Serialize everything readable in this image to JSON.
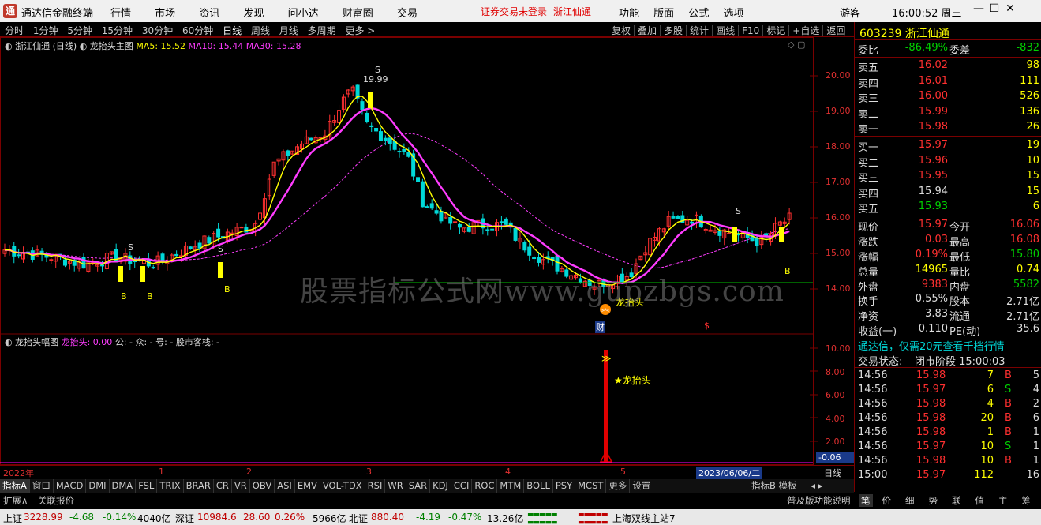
{
  "titlebar": {
    "app_name": "通达信金融终端",
    "menu": [
      "行情",
      "市场",
      "资讯",
      "发现",
      "问小达",
      "财富圈",
      "交易"
    ],
    "notice": "证券交易未登录",
    "stock_name": "浙江仙通",
    "right_menu": [
      "功能",
      "版面",
      "公式",
      "选项"
    ],
    "guest": "游客",
    "clock": "16:00:52 周三"
  },
  "toolbar": {
    "periods": [
      "分时",
      "1分钟",
      "5分钟",
      "15分钟",
      "30分钟",
      "60分钟",
      "日线",
      "周线",
      "月线",
      "多周期",
      "更多 >"
    ],
    "active_period": "日线",
    "tools": [
      "复权",
      "叠加",
      "多股",
      "统计",
      "画线",
      "F10",
      "标记",
      "+自选",
      "返回"
    ]
  },
  "main_chart": {
    "stock_label": "浙江仙通 (日线)",
    "indicator_name": "龙抬头主图",
    "ma5": "MA5: 15.52",
    "ma10": "MA10: 15.44",
    "ma30": "MA30: 15.28",
    "peak_label": "19.99",
    "low_label": "龙抬头",
    "marker_cai": "财",
    "marker_s": "$",
    "y_axis": [
      "20.00",
      "19.00",
      "18.00",
      "17.00",
      "16.00",
      "15.00",
      "14.00"
    ],
    "x_axis": [
      "2022年",
      "1",
      "2",
      "3",
      "4",
      "5"
    ],
    "watermark": "股票指标公式网www.gupzbgs.com"
  },
  "sub_chart": {
    "title": "龙抬头幅图",
    "value": "龙抬头: 0.00",
    "extras": "公: -  众: -  号: -  股市客栈: -",
    "annotation": "★龙抬头",
    "y_axis": [
      "10.00",
      "8.00",
      "6.00",
      "4.00",
      "2.00"
    ],
    "current": "-0.06",
    "date_box": "2023/06/06/二",
    "period_box": "日线"
  },
  "panel": {
    "code": "603239",
    "name": "浙江仙通",
    "weibi_label": "委比",
    "weibi": "-86.49%",
    "weicha_label": "委差",
    "weicha": "-832",
    "sell": [
      {
        "label": "卖五",
        "price": "16.02",
        "vol": "98"
      },
      {
        "label": "卖四",
        "price": "16.01",
        "vol": "111"
      },
      {
        "label": "卖三",
        "price": "16.00",
        "vol": "526"
      },
      {
        "label": "卖二",
        "price": "15.99",
        "vol": "136"
      },
      {
        "label": "卖一",
        "price": "15.98",
        "vol": "26"
      }
    ],
    "buy": [
      {
        "label": "买一",
        "price": "15.97",
        "vol": "19"
      },
      {
        "label": "买二",
        "price": "15.96",
        "vol": "10"
      },
      {
        "label": "买三",
        "price": "15.95",
        "vol": "15"
      },
      {
        "label": "买四",
        "price": "15.94",
        "vol": "15"
      },
      {
        "label": "买五",
        "price": "15.93",
        "vol": "6"
      }
    ],
    "stats": [
      {
        "l1": "现价",
        "v1": "15.97",
        "l2": "今开",
        "v2": "16.06"
      },
      {
        "l1": "涨跌",
        "v1": "0.03",
        "l2": "最高",
        "v2": "16.08"
      },
      {
        "l1": "涨幅",
        "v1": "0.19%",
        "l2": "最低",
        "v2": "15.80"
      },
      {
        "l1": "总量",
        "v1": "14965",
        "l2": "量比",
        "v2": "0.74"
      },
      {
        "l1": "外盘",
        "v1": "9383",
        "l2": "内盘",
        "v2": "5582"
      }
    ],
    "stats2": [
      {
        "l1": "换手",
        "v1": "0.55%",
        "l2": "股本",
        "v2": "2.71亿"
      },
      {
        "l1": "净资",
        "v1": "3.83",
        "l2": "流通",
        "v2": "2.71亿"
      },
      {
        "l1": "收益(一)",
        "v1": "0.110",
        "l2": "PE(动)",
        "v2": "35.6"
      }
    ],
    "promo": "通达信，仅需20元查看千档行情",
    "trade_state_label": "交易状态:",
    "trade_state": "闭市阶段 15:00:03",
    "ticks": [
      {
        "t": "14:56",
        "p": "15.98",
        "v": "7",
        "d": "B",
        "n": "5"
      },
      {
        "t": "14:56",
        "p": "15.97",
        "v": "6",
        "d": "S",
        "n": "4"
      },
      {
        "t": "14:56",
        "p": "15.98",
        "v": "4",
        "d": "B",
        "n": "2"
      },
      {
        "t": "14:56",
        "p": "15.98",
        "v": "20",
        "d": "B",
        "n": "6"
      },
      {
        "t": "14:56",
        "p": "15.98",
        "v": "1",
        "d": "B",
        "n": "1"
      },
      {
        "t": "14:56",
        "p": "15.97",
        "v": "10",
        "d": "S",
        "n": "1"
      },
      {
        "t": "14:56",
        "p": "15.98",
        "v": "10",
        "d": "B",
        "n": "1"
      },
      {
        "t": "15:00",
        "p": "15.97",
        "v": "112",
        "d": "",
        "n": "16"
      }
    ]
  },
  "tabs": [
    "指标A",
    "窗口",
    "MACD",
    "DMI",
    "DMA",
    "FSL",
    "TRIX",
    "BRAR",
    "CR",
    "VR",
    "OBV",
    "ASI",
    "EMV",
    "VOL-TDX",
    "RSI",
    "WR",
    "SAR",
    "KDJ",
    "CCI",
    "ROC",
    "MTM",
    "BOLL",
    "PSY",
    "MCST",
    "更多",
    "设置"
  ],
  "tabs_right": [
    "指标B",
    "模板"
  ],
  "subtabs": [
    "扩展∧",
    "关联报价"
  ],
  "subtabs_right": "普及版功能说明",
  "panel_tabs": [
    "笔",
    "价",
    "细",
    "势",
    "联",
    "值",
    "主",
    "筹"
  ],
  "statusbar": {
    "sh_label": "上证",
    "sh": "3228.99",
    "sh_chg": "-4.68",
    "sh_pct": "-0.14%",
    "sh_amt": "4040亿",
    "sz_label": "深证",
    "sz": "10984.6",
    "sz_chg": "28.60",
    "sz_pct": "0.26%",
    "sz_amt": "5966亿",
    "bz_label": "北证",
    "bz": "880.40",
    "bz_chg": "-4.19",
    "bz_pct": "-0.47%",
    "bz_amt": "13.26亿",
    "server": "上海双线主站7"
  },
  "colors": {
    "up": "#ff3030",
    "down": "#00d8d8",
    "ma5": "#ffff00",
    "ma10": "#ff3cff",
    "ma30": "#ff3cff",
    "border": "#7a0000"
  }
}
